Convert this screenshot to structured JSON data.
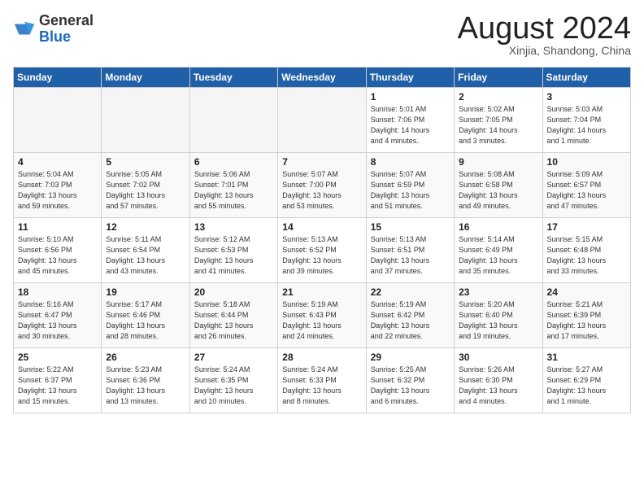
{
  "header": {
    "logo_general": "General",
    "logo_blue": "Blue",
    "month_title": "August 2024",
    "location": "Xinjia, Shandong, China"
  },
  "weekdays": [
    "Sunday",
    "Monday",
    "Tuesday",
    "Wednesday",
    "Thursday",
    "Friday",
    "Saturday"
  ],
  "weeks": [
    [
      {
        "day": "",
        "info": ""
      },
      {
        "day": "",
        "info": ""
      },
      {
        "day": "",
        "info": ""
      },
      {
        "day": "",
        "info": ""
      },
      {
        "day": "1",
        "info": "Sunrise: 5:01 AM\nSunset: 7:06 PM\nDaylight: 14 hours\nand 4 minutes."
      },
      {
        "day": "2",
        "info": "Sunrise: 5:02 AM\nSunset: 7:05 PM\nDaylight: 14 hours\nand 3 minutes."
      },
      {
        "day": "3",
        "info": "Sunrise: 5:03 AM\nSunset: 7:04 PM\nDaylight: 14 hours\nand 1 minute."
      }
    ],
    [
      {
        "day": "4",
        "info": "Sunrise: 5:04 AM\nSunset: 7:03 PM\nDaylight: 13 hours\nand 59 minutes."
      },
      {
        "day": "5",
        "info": "Sunrise: 5:05 AM\nSunset: 7:02 PM\nDaylight: 13 hours\nand 57 minutes."
      },
      {
        "day": "6",
        "info": "Sunrise: 5:06 AM\nSunset: 7:01 PM\nDaylight: 13 hours\nand 55 minutes."
      },
      {
        "day": "7",
        "info": "Sunrise: 5:07 AM\nSunset: 7:00 PM\nDaylight: 13 hours\nand 53 minutes."
      },
      {
        "day": "8",
        "info": "Sunrise: 5:07 AM\nSunset: 6:59 PM\nDaylight: 13 hours\nand 51 minutes."
      },
      {
        "day": "9",
        "info": "Sunrise: 5:08 AM\nSunset: 6:58 PM\nDaylight: 13 hours\nand 49 minutes."
      },
      {
        "day": "10",
        "info": "Sunrise: 5:09 AM\nSunset: 6:57 PM\nDaylight: 13 hours\nand 47 minutes."
      }
    ],
    [
      {
        "day": "11",
        "info": "Sunrise: 5:10 AM\nSunset: 6:56 PM\nDaylight: 13 hours\nand 45 minutes."
      },
      {
        "day": "12",
        "info": "Sunrise: 5:11 AM\nSunset: 6:54 PM\nDaylight: 13 hours\nand 43 minutes."
      },
      {
        "day": "13",
        "info": "Sunrise: 5:12 AM\nSunset: 6:53 PM\nDaylight: 13 hours\nand 41 minutes."
      },
      {
        "day": "14",
        "info": "Sunrise: 5:13 AM\nSunset: 6:52 PM\nDaylight: 13 hours\nand 39 minutes."
      },
      {
        "day": "15",
        "info": "Sunrise: 5:13 AM\nSunset: 6:51 PM\nDaylight: 13 hours\nand 37 minutes."
      },
      {
        "day": "16",
        "info": "Sunrise: 5:14 AM\nSunset: 6:49 PM\nDaylight: 13 hours\nand 35 minutes."
      },
      {
        "day": "17",
        "info": "Sunrise: 5:15 AM\nSunset: 6:48 PM\nDaylight: 13 hours\nand 33 minutes."
      }
    ],
    [
      {
        "day": "18",
        "info": "Sunrise: 5:16 AM\nSunset: 6:47 PM\nDaylight: 13 hours\nand 30 minutes."
      },
      {
        "day": "19",
        "info": "Sunrise: 5:17 AM\nSunset: 6:46 PM\nDaylight: 13 hours\nand 28 minutes."
      },
      {
        "day": "20",
        "info": "Sunrise: 5:18 AM\nSunset: 6:44 PM\nDaylight: 13 hours\nand 26 minutes."
      },
      {
        "day": "21",
        "info": "Sunrise: 5:19 AM\nSunset: 6:43 PM\nDaylight: 13 hours\nand 24 minutes."
      },
      {
        "day": "22",
        "info": "Sunrise: 5:19 AM\nSunset: 6:42 PM\nDaylight: 13 hours\nand 22 minutes."
      },
      {
        "day": "23",
        "info": "Sunrise: 5:20 AM\nSunset: 6:40 PM\nDaylight: 13 hours\nand 19 minutes."
      },
      {
        "day": "24",
        "info": "Sunrise: 5:21 AM\nSunset: 6:39 PM\nDaylight: 13 hours\nand 17 minutes."
      }
    ],
    [
      {
        "day": "25",
        "info": "Sunrise: 5:22 AM\nSunset: 6:37 PM\nDaylight: 13 hours\nand 15 minutes."
      },
      {
        "day": "26",
        "info": "Sunrise: 5:23 AM\nSunset: 6:36 PM\nDaylight: 13 hours\nand 13 minutes."
      },
      {
        "day": "27",
        "info": "Sunrise: 5:24 AM\nSunset: 6:35 PM\nDaylight: 13 hours\nand 10 minutes."
      },
      {
        "day": "28",
        "info": "Sunrise: 5:24 AM\nSunset: 6:33 PM\nDaylight: 13 hours\nand 8 minutes."
      },
      {
        "day": "29",
        "info": "Sunrise: 5:25 AM\nSunset: 6:32 PM\nDaylight: 13 hours\nand 6 minutes."
      },
      {
        "day": "30",
        "info": "Sunrise: 5:26 AM\nSunset: 6:30 PM\nDaylight: 13 hours\nand 4 minutes."
      },
      {
        "day": "31",
        "info": "Sunrise: 5:27 AM\nSunset: 6:29 PM\nDaylight: 13 hours\nand 1 minute."
      }
    ]
  ]
}
